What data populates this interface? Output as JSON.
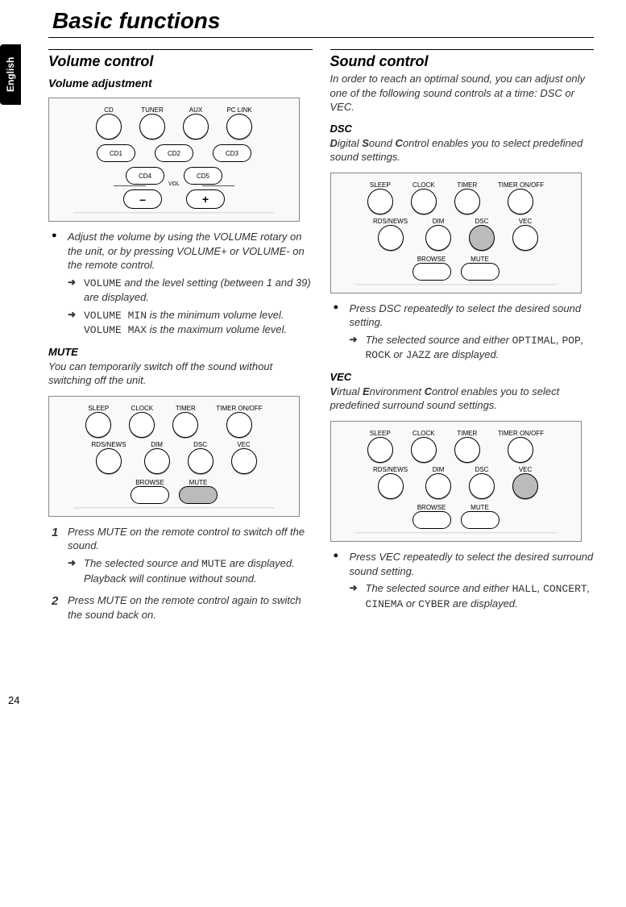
{
  "chapter_title": "Basic functions",
  "lang_tab": "English",
  "page_number": "24",
  "left": {
    "h2": "Volume control",
    "h3": "Volume adjustment",
    "remote1": {
      "row1": [
        "CD",
        "TUNER",
        "AUX",
        "PC LINK"
      ],
      "ovals1": [
        "CD1",
        "CD2",
        "CD3"
      ],
      "ovals2": [
        "CD4",
        "CD5"
      ],
      "vol_label": "VOL",
      "pills": [
        "–",
        "+"
      ]
    },
    "vol_bullet": "Adjust the volume by using the VOLUME rotary on the unit, or by pressing VOLUME+ or VOLUME- on the remote control.",
    "vol_sub1_code": "VOLUME",
    "vol_sub1_text": " and the level setting (between 1 and 39) are displayed.",
    "vol_sub2_code1": "VOLUME MIN",
    "vol_sub2_mid": " is the minimum volume level. ",
    "vol_sub2_code2": "VOLUME MAX",
    "vol_sub2_end": " is the maximum volume level.",
    "mute_h": "MUTE",
    "mute_intro": "You can temporarily switch off the sound without switching off the unit.",
    "remote2": {
      "row1": [
        "SLEEP",
        "CLOCK",
        "TIMER",
        "TIMER ON/OFF"
      ],
      "row2": [
        "RDS/NEWS",
        "DIM",
        "DSC",
        "VEC"
      ],
      "bottom": [
        "BROWSE",
        "MUTE"
      ]
    },
    "step1": "Press MUTE on the remote control to switch off the sound.",
    "step1_sub_a": "The selected source and ",
    "step1_sub_code": "MUTE",
    "step1_sub_b": " are displayed. Playback will continue without sound.",
    "step2": "Press MUTE on the remote control again to switch the sound back on."
  },
  "right": {
    "h2": "Sound control",
    "intro": "In order to reach an optimal sound, you can adjust only one of the following sound controls at a time: DSC or VEC.",
    "dsc_h": "DSC",
    "dsc_intro_pre": "D",
    "dsc_intro_mid1": "igital ",
    "dsc_intro_b2": "S",
    "dsc_intro_mid2": "ound ",
    "dsc_intro_b3": "C",
    "dsc_intro_end": "ontrol enables you to select predefined sound settings.",
    "remote3": {
      "row1": [
        "SLEEP",
        "CLOCK",
        "TIMER",
        "TIMER ON/OFF"
      ],
      "row2": [
        "RDS/NEWS",
        "DIM",
        "DSC",
        "VEC"
      ],
      "bottom": [
        "BROWSE",
        "MUTE"
      ]
    },
    "dsc_bullet": "Press DSC repeatedly to select the desired sound setting.",
    "dsc_sub_a": "The selected source and either ",
    "dsc_c1": "OPTIMAL",
    "dsc_sep1": ", ",
    "dsc_c2": "POP",
    "dsc_sep2": ", ",
    "dsc_c3": "ROCK",
    "dsc_sep3": " or ",
    "dsc_c4": "JAZZ",
    "dsc_sub_b": " are displayed.",
    "vec_h": "VEC",
    "vec_intro_pre": "V",
    "vec_intro_mid1": "irtual ",
    "vec_intro_b2": "E",
    "vec_intro_mid2": "nvironment ",
    "vec_intro_b3": "C",
    "vec_intro_end": "ontrol enables you to select predefined surround sound settings.",
    "remote4": {
      "row1": [
        "SLEEP",
        "CLOCK",
        "TIMER",
        "TIMER ON/OFF"
      ],
      "row2": [
        "RDS/NEWS",
        "DIM",
        "DSC",
        "VEC"
      ],
      "bottom": [
        "BROWSE",
        "MUTE"
      ]
    },
    "vec_bullet": "Press VEC repeatedly to select the desired surround sound setting.",
    "vec_sub_a": "The selected source and either ",
    "vec_c1": "HALL",
    "vec_sep1": ", ",
    "vec_c2": "CONCERT",
    "vec_sep2": ", ",
    "vec_c3": "CINEMA",
    "vec_sep3": " or ",
    "vec_c4": "CYBER",
    "vec_sub_b": " are displayed."
  }
}
